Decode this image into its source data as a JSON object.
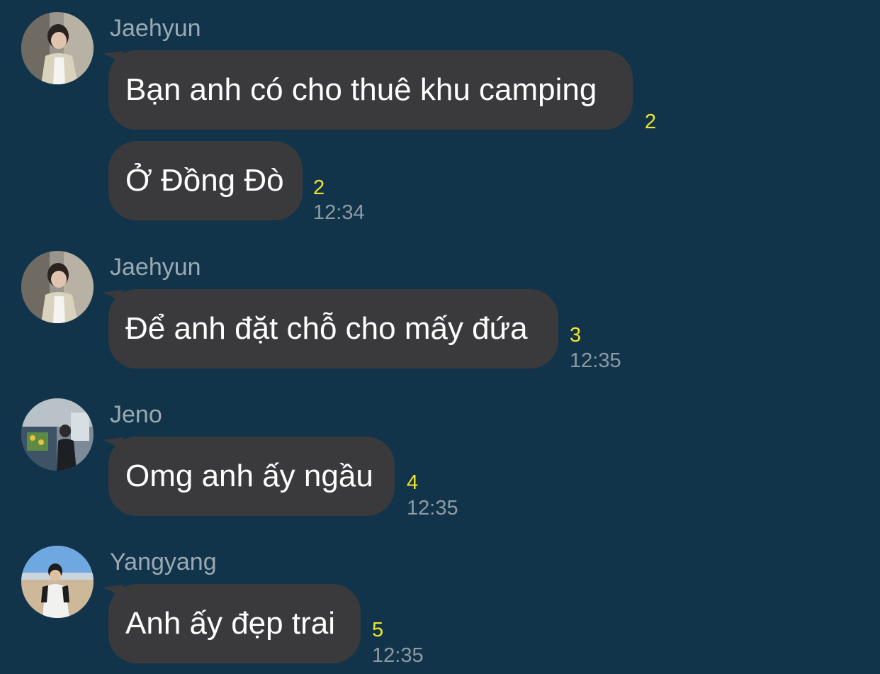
{
  "colors": {
    "background": "#12344a",
    "bubble": "#3a3a3c",
    "bubble_text": "#ffffff",
    "sender_name": "#9aa9b3",
    "unread_count": "#f0e330",
    "timestamp": "#8e9ba4"
  },
  "messages": [
    {
      "sender": "Jaehyun",
      "avatar": "avatar-photo-jaehyun",
      "text": "Bạn anh có cho thuê khu camping",
      "unread": "2",
      "time": ""
    },
    {
      "sender": "",
      "avatar": "",
      "text": "Ở Đồng Đò",
      "unread": "2",
      "time": "12:34"
    },
    {
      "sender": "Jaehyun",
      "avatar": "avatar-photo-jaehyun",
      "text": "Để anh đặt chỗ cho mấy đứa",
      "unread": "3",
      "time": "12:35"
    },
    {
      "sender": "Jeno",
      "avatar": "avatar-photo-jeno",
      "text": "Omg anh ấy ngầu",
      "unread": "4",
      "time": "12:35"
    },
    {
      "sender": "Yangyang",
      "avatar": "avatar-photo-yangyang",
      "text": "Anh ấy đẹp trai",
      "unread": "5",
      "time": "12:35"
    }
  ]
}
